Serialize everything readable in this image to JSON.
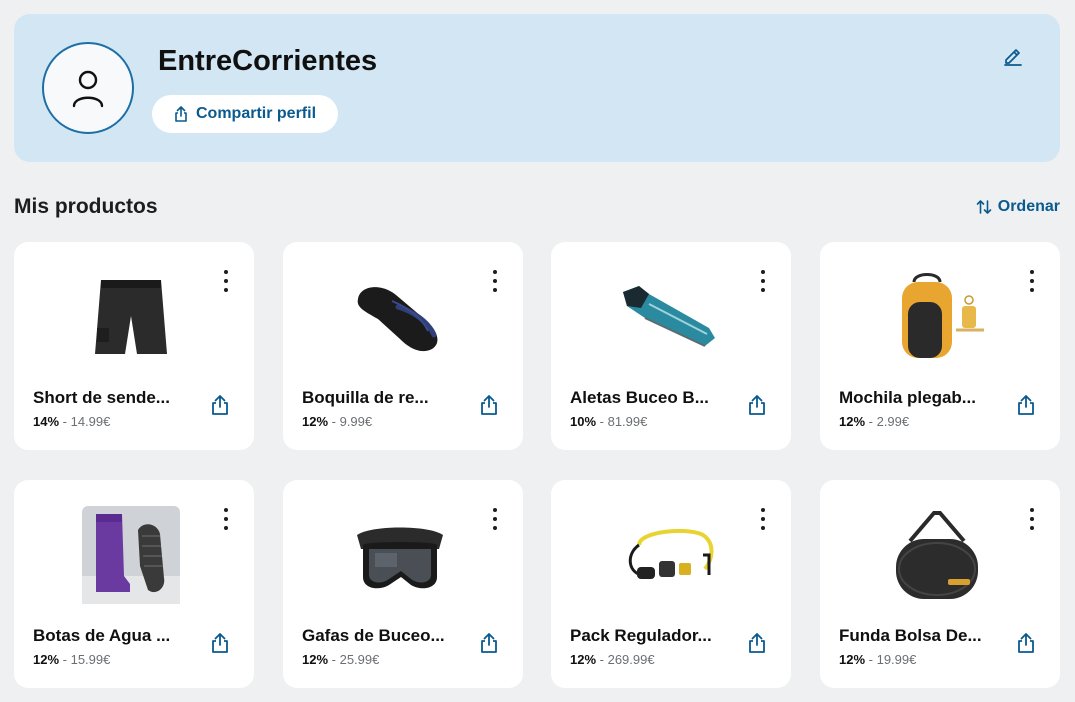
{
  "profile": {
    "name": "EntreCorrientes",
    "share_label": "Compartir perfil"
  },
  "products_section": {
    "title": "Mis productos",
    "sort_label": "Ordenar"
  },
  "products": [
    {
      "name": "Short de sende...",
      "discount": "14%",
      "separator": " - ",
      "price": "14.99€",
      "image": "black-shorts"
    },
    {
      "name": "Boquilla de re...",
      "discount": "12%",
      "separator": " - ",
      "price": "9.99€",
      "image": "snorkel-mouthpiece"
    },
    {
      "name": "Aletas Buceo B...",
      "discount": "10%",
      "separator": " - ",
      "price": "81.99€",
      "image": "diving-fin"
    },
    {
      "name": "Mochila plegab...",
      "discount": "12%",
      "separator": " - ",
      "price": "2.99€",
      "image": "foldable-backpack"
    },
    {
      "name": "Botas de Agua ...",
      "discount": "12%",
      "separator": " - ",
      "price": "15.99€",
      "image": "rain-boots"
    },
    {
      "name": "Gafas de Buceo...",
      "discount": "12%",
      "separator": " - ",
      "price": "25.99€",
      "image": "diving-mask"
    },
    {
      "name": "Pack Regulador...",
      "discount": "12%",
      "separator": " - ",
      "price": "269.99€",
      "image": "dive-regulator"
    },
    {
      "name": "Funda Bolsa De...",
      "discount": "12%",
      "separator": " - ",
      "price": "19.99€",
      "image": "duffel-bag"
    }
  ],
  "colors": {
    "accent": "#0a5a8e",
    "profile_bg": "#d3e6f3",
    "page_bg": "#eef0f2"
  }
}
